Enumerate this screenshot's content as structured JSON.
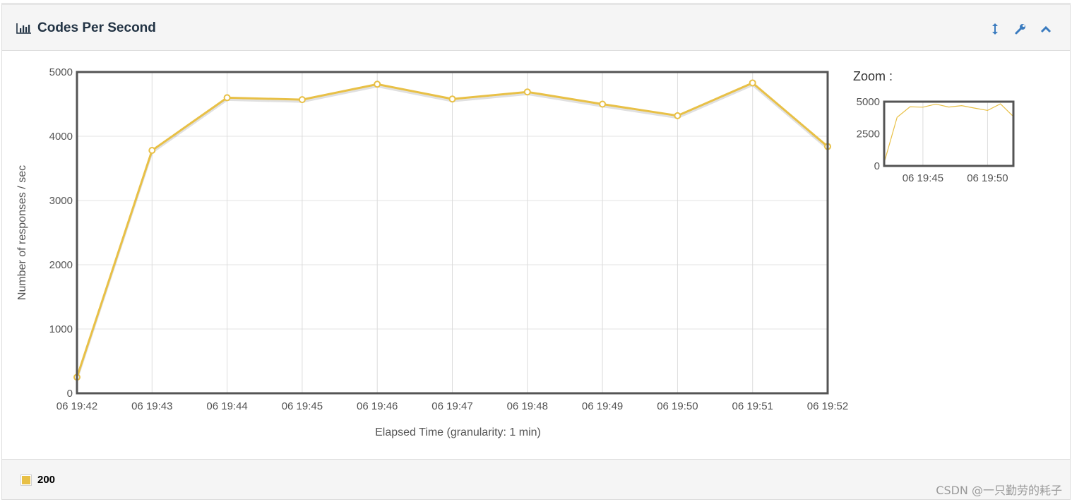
{
  "panel": {
    "title": "Codes Per Second",
    "icons": {
      "title": "bar-chart-icon",
      "resize": "resize-vertical-icon",
      "settings": "wrench-icon",
      "collapse": "chevron-up-icon"
    }
  },
  "chart_data": {
    "type": "line",
    "xlabel": "Elapsed Time (granularity: 1 min)",
    "ylabel": "Number of responses / sec",
    "x": [
      "06 19:42",
      "06 19:43",
      "06 19:44",
      "06 19:45",
      "06 19:46",
      "06 19:47",
      "06 19:48",
      "06 19:49",
      "06 19:50",
      "06 19:51",
      "06 19:52"
    ],
    "series": [
      {
        "name": "200",
        "color": "#e8c046",
        "values": [
          250,
          3780,
          4600,
          4570,
          4810,
          4580,
          4690,
          4500,
          4320,
          4830,
          3840
        ]
      }
    ],
    "ylim": [
      0,
      5000
    ],
    "yticks": [
      "0",
      "1000",
      "2000",
      "3000",
      "4000",
      "5000"
    ],
    "grid": true,
    "legend": "bottom"
  },
  "zoom": {
    "label": "Zoom :",
    "yticks": [
      "0",
      "2500",
      "5000"
    ],
    "xticks": [
      "06 19:45",
      "06 19:50"
    ],
    "xtick_index": [
      3,
      8
    ],
    "ylim": [
      0,
      5000
    ]
  },
  "legend": {
    "label": "200",
    "color": "#e8c046"
  },
  "watermark": "CSDN @一只勤劳的耗子"
}
